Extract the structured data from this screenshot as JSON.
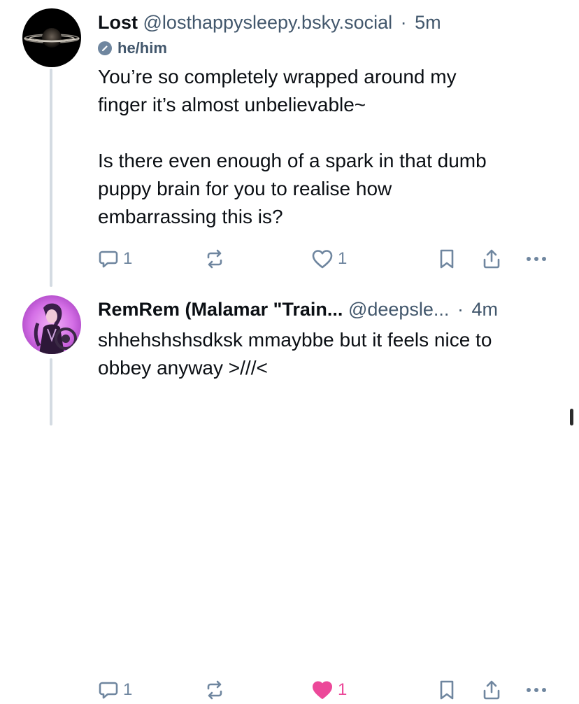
{
  "posts": [
    {
      "author": {
        "display_name": "Lost",
        "handle": "@losthappysleepy.bsky.social",
        "pronouns": "he/him",
        "avatar_icon": "saturn-avatar"
      },
      "time": "5m",
      "separator": "·",
      "text": "You’re so completely wrapped around my\nfinger it’s almost unbelievable~\n\nIs there even enough of a spark in that dumb\npuppy brain for you to realise how\nembarrassing this is?",
      "actions": {
        "reply_count": "1",
        "like_count": "1",
        "liked": false
      }
    },
    {
      "author": {
        "display_name": "RemRem (Malamar \"Train...",
        "handle": "@deepsle...",
        "avatar_icon": "anime-character-avatar"
      },
      "time": "4m",
      "separator": "·",
      "text": "shhehshshsdksk mmaybbe but it feels nice to\nobbey anyway >///<",
      "actions": {
        "reply_count": "1",
        "like_count": "1",
        "liked": true
      }
    }
  ],
  "colors": {
    "text": "#0b0f14",
    "muted": "#42576c",
    "icon": "#6f869f",
    "like_active": "#ec4899",
    "thread_line": "#d4dbe2"
  }
}
